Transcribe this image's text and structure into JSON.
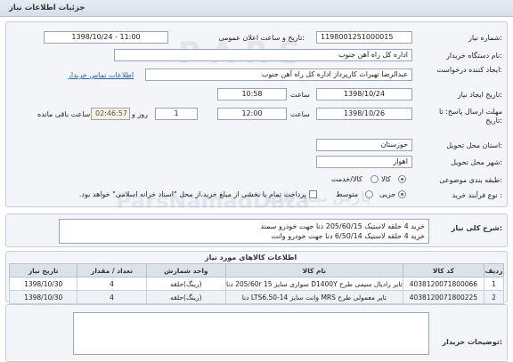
{
  "header": {
    "title": "جزئیات اطلاعات نیاز"
  },
  "form": {
    "need_number_label": "شماره نیاز:",
    "need_number": "1198001251000015",
    "announce_label": "تاریخ و ساعت اعلان عمومی:",
    "announce_value": "1398/10/24 - 11:00",
    "buyer_org_label": "نام دستگاه خریدار:",
    "buyer_org": "اداره کل راه آهن جنوب",
    "requester_label": "ایجاد کننده درخواست:",
    "requester": "عبدالرضا تهیراث کارپرداز اداره کل راه آهن جنوب",
    "contact_link": "اطلاعات تماس خریدار",
    "create_date_label": "تاریخ ایجاد نیاز:",
    "create_date": "1398/10/24",
    "time_label": "ساعت",
    "create_time": "10:58",
    "deadline_label": "مهلت ارسال پاسخ: تا تاریخ:",
    "deadline_date": "1398/10/26",
    "deadline_time": "12:00",
    "days_value": "1",
    "days_label": "روز و",
    "remaining_time": "02:46:57",
    "remaining_label": "ساعت باقی مانده",
    "province_label": "استان محل تحویل:",
    "province": "خوزستان",
    "city_label": "شهر محل تحویل:",
    "city": "اهواز",
    "category_label": "طبقه بندی موضوعی:",
    "category_options": [
      "کالا",
      "کالا/خدمت"
    ],
    "process_label": "نوع فرآیند خرید :",
    "process_options": [
      "جزیی",
      "متوسط"
    ],
    "payment_text": "پرداخت تمام یا بخشی از مبلغ خرید،از محل \"اسناد خزانه اسلامی\" خواهد بود."
  },
  "description": {
    "label": "شرح کلی نیاز:",
    "lines": [
      "خرید 4 حلقه لاستیک 205/60/15 دنا جهت خودرو سمند",
      "خرید 4 حلقه لاستیک 6/50/14 دنا جهت خودرو وانت"
    ]
  },
  "goods": {
    "title": "اطلاعات کالاهای مورد نیاز",
    "columns": [
      "ردیف",
      "کد کالا",
      "نام کالا",
      "واحد شمارش",
      "تعداد / مقدار",
      "تاریخ نیاز"
    ],
    "rows": [
      [
        "1",
        "4038120071800066",
        "تایر رادیال سیمی طرح D1400Y سواری سایز 15 205/60r دنا",
        "(رینگ)حلقه",
        "4",
        "1398/10/30"
      ],
      [
        "2",
        "4038120071800225",
        "تایر معمولی طرح MRS وانت سایز 14-LTS6.50 دنا",
        "(رینگ)حلقه",
        "4",
        "1398/10/30"
      ]
    ]
  },
  "notes": {
    "label": "توضیحات خریدار:"
  },
  "watermarks": [
    "پارس نماد داده",
    "ParsNamadData",
    "پایگاه اطلاع رسانی مناقصه و مزایده ایران"
  ]
}
